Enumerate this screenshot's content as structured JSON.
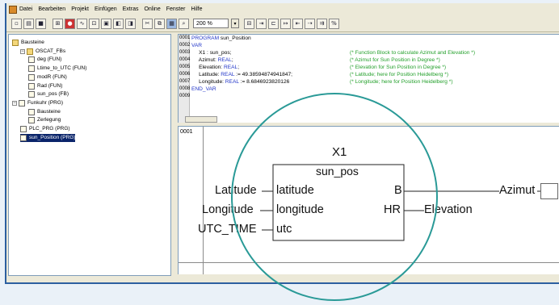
{
  "menu": [
    "Datei",
    "Bearbeiten",
    "Projekt",
    "Einfügen",
    "Extras",
    "Online",
    "Fenster",
    "Hilfe"
  ],
  "toolbar": {
    "zoom": "200 %",
    "zoom_dropdown": "▾"
  },
  "tree": {
    "items": [
      {
        "label": "Bausteine",
        "level": 0,
        "expander": "",
        "icon": "folder"
      },
      {
        "label": "OSCAT_FBs",
        "level": 1,
        "expander": "−",
        "icon": "folder"
      },
      {
        "label": "deg (FUN)",
        "level": 2,
        "expander": "",
        "icon": "file"
      },
      {
        "label": "Ltime_to_UTC (FUN)",
        "level": 2,
        "expander": "",
        "icon": "file"
      },
      {
        "label": "modR (FUN)",
        "level": 2,
        "expander": "",
        "icon": "file"
      },
      {
        "label": "Rad (FUN)",
        "level": 2,
        "expander": "",
        "icon": "file"
      },
      {
        "label": "sun_pos (FB)",
        "level": 2,
        "expander": "",
        "icon": "file"
      },
      {
        "label": "Funkuhr (PRG)",
        "level": 0,
        "expander": "−",
        "icon": "file"
      },
      {
        "label": "Bausteine",
        "level": 2,
        "expander": "",
        "icon": "file"
      },
      {
        "label": "Zerlegung",
        "level": 2,
        "expander": "",
        "icon": "file"
      },
      {
        "label": "PLC_PRG (PRG)",
        "level": 1,
        "expander": "",
        "icon": "file"
      },
      {
        "label": "sun_Position (PRG)",
        "level": 1,
        "expander": "",
        "icon": "file",
        "selected": true
      }
    ]
  },
  "code": {
    "line_numbers": [
      "0001",
      "0002",
      "0003",
      "0004",
      "0005",
      "0006",
      "0007",
      "0008",
      "0009"
    ],
    "lines": [
      {
        "kw": "PROGRAM",
        "text": " sun_Position",
        "comment": ""
      },
      {
        "kw": "VAR",
        "text": "",
        "comment": ""
      },
      {
        "kw": "",
        "text": "     X1 : sun_pos;",
        "comment": "(* Function Block to calculate Azimut and Elevation *)"
      },
      {
        "kw": "",
        "text": "     Azimut: ",
        "kw2": "REAL",
        "text2": ";",
        "comment": "(* Azimut for Sun Position in Degree *)"
      },
      {
        "kw": "",
        "text": "     Elevation: ",
        "kw2": "REAL",
        "text2": ";",
        "comment": "(* Elevation for Sun Position in Degree *)"
      },
      {
        "kw": "",
        "text": "     Latitude: ",
        "kw2": "REAL",
        "text2": " := 49.38594874941847;",
        "comment": "(* Latitude; here for Position Heidelberg *)"
      },
      {
        "kw": "",
        "text": "     Longitude: ",
        "kw2": "REAL",
        "text2": " := 8.6846923820126",
        "comment": "(* Longitude; here for Position Heidelberg *)"
      },
      {
        "kw": "END_VAR",
        "text": "",
        "comment": ""
      },
      {
        "kw": "",
        "text": "",
        "comment": ""
      }
    ]
  },
  "diagram": {
    "network_number": "0001",
    "instance_name": "X1",
    "block_type": "sun_pos",
    "inputs": [
      {
        "var": "Latitude",
        "pin": "latitude"
      },
      {
        "var": "Longitude",
        "pin": "longitude"
      },
      {
        "var": "UTC_TIME",
        "pin": "utc"
      }
    ],
    "outputs": [
      {
        "pin": "B",
        "var": "Azimut"
      },
      {
        "pin": "HR",
        "var": "Elevation"
      }
    ]
  },
  "colors": {
    "keyword": "#2236c8",
    "comment": "#24a02c",
    "callout_circle": "#2a9a97",
    "selection": "#0a246a"
  }
}
